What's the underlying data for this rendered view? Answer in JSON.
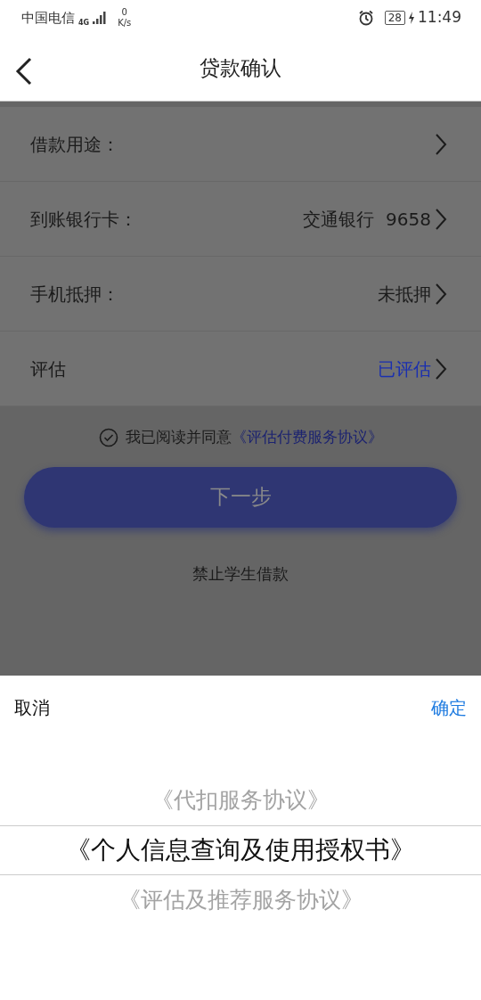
{
  "status_bar": {
    "carrier": "中国电信",
    "network": "4G",
    "speed_value": "0",
    "speed_unit": "K/s",
    "battery": "28",
    "time": "11:49"
  },
  "header": {
    "title": "贷款确认"
  },
  "form_rows": [
    {
      "label": "借款用途："
    },
    {
      "label": "到账银行卡：",
      "value": "交通银行  9658",
      "highlight": false
    },
    {
      "label": "手机抵押：",
      "value": "未抵押",
      "highlight": false
    },
    {
      "label": "评估",
      "value": "已评估",
      "highlight": true
    }
  ],
  "agreement": {
    "checked": true,
    "text": "我已阅读并同意",
    "link": "《评估付费服务协议》"
  },
  "next_button": {
    "label": "下一步"
  },
  "notice": "禁止学生借款",
  "picker": {
    "cancel": "取消",
    "confirm": "确定",
    "options": [
      {
        "label": "《代扣服务协议》",
        "selected": false
      },
      {
        "label": "《个人信息查询及使用授权书》",
        "selected": true
      },
      {
        "label": "《评估及推荐服务协议》",
        "selected": false
      }
    ]
  }
}
